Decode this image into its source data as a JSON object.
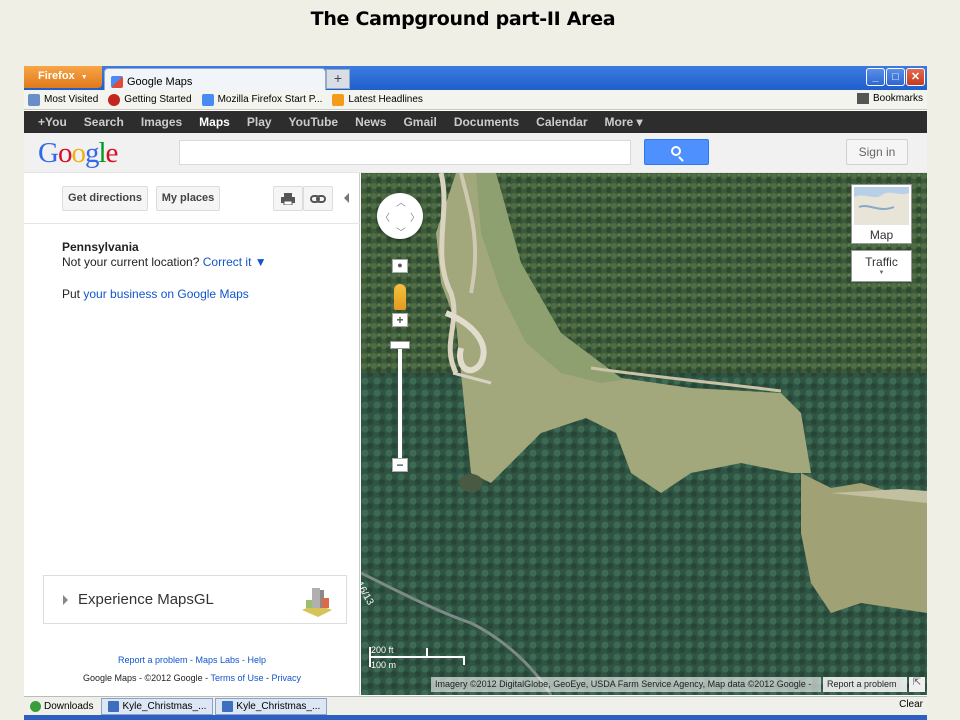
{
  "slide": {
    "title": "The Campground part-II Area"
  },
  "browser": {
    "app_button": "Firefox",
    "tab_title": "Google Maps",
    "new_tab": "+",
    "window_buttons": [
      "_",
      "□",
      "✕"
    ]
  },
  "bookmarks": {
    "items": [
      "Most Visited",
      "Getting Started",
      "Mozilla Firefox Start P...",
      "Latest Headlines"
    ],
    "right": "Bookmarks"
  },
  "google_bar": {
    "items": [
      "+You",
      "Search",
      "Images",
      "Maps",
      "Play",
      "YouTube",
      "News",
      "Gmail",
      "Documents",
      "Calendar",
      "More ▾"
    ],
    "active": "Maps"
  },
  "header": {
    "logo": [
      "G",
      "o",
      "o",
      "g",
      "l",
      "e"
    ],
    "logo_colors": [
      "#3369e8",
      "#d50f25",
      "#eeb211",
      "#3369e8",
      "#009925",
      "#d50f25"
    ],
    "search_value": "",
    "sign_in": "Sign in"
  },
  "left_panel": {
    "get_directions": "Get directions",
    "my_places": "My places",
    "location": "Pennsylvania",
    "not_location": "Not your current location?",
    "correct_it": "Correct it ▼",
    "put_prefix": "Put",
    "business_link": "your business on Google Maps",
    "mapsgl": "Experience MapsGL",
    "footer_links": "Report a problem - Maps Labs - Help",
    "copyright": "Google Maps - ©2012 Google -",
    "terms": "Terms of Use",
    "privacy": "Privacy"
  },
  "map": {
    "map_type": "Map",
    "traffic": "Traffic",
    "scale_ft": "200 ft",
    "scale_m": "100 m",
    "road_label": "16/13",
    "attribution": "Imagery ©2012 DigitalGlobe, GeoEye, USDA Farm Service Agency, Map data ©2012 Google -",
    "report": "Report a problem"
  },
  "downloads_bar": {
    "items": [
      "Downloads",
      "Kyle_Christmas_...",
      "Kyle_Christmas_..."
    ],
    "clear": "Clear"
  },
  "colors": {
    "google_blue": "#4d90fe",
    "link": "#1155cc",
    "firefox_orange": "#e8861f"
  }
}
